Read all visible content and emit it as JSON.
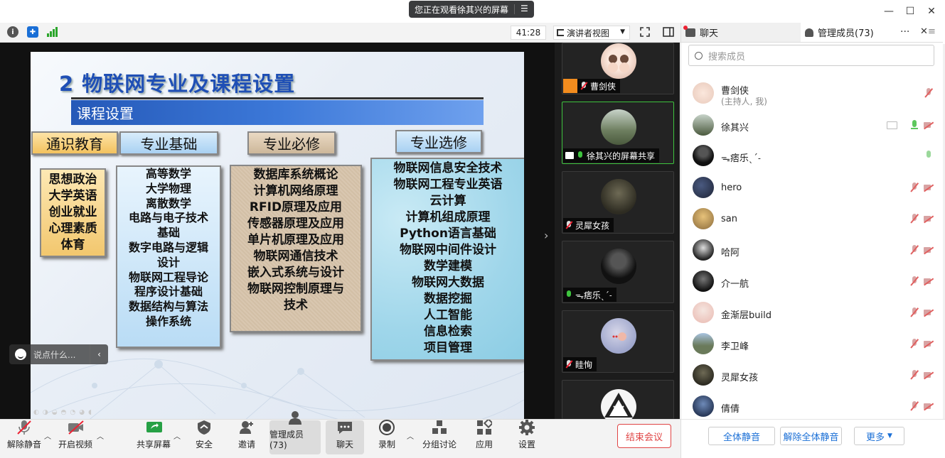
{
  "window": {
    "sharing_banner": "您正在观看徐其兴的屏幕"
  },
  "toolbar_top": {
    "timer": "41:28",
    "view_label": "演讲者视图"
  },
  "slide": {
    "title": "2 物联网专业及课程设置",
    "ribbon": "课程设置",
    "categories": [
      {
        "header": "通识教育",
        "items": [
          "思想政治",
          "大学英语",
          "创业就业",
          "心理素质",
          "体育"
        ]
      },
      {
        "header": "专业基础",
        "items": [
          "高等数学",
          "大学物理",
          "离散数学",
          "电路与电子技术",
          "基础",
          "数字电路与逻辑",
          "设计",
          "物联网工程导论",
          "程序设计基础",
          "数据结构与算法",
          "操作系统"
        ]
      },
      {
        "header": "专业必修",
        "items": [
          "数据库系统概论",
          "计算机网络原理",
          "RFID原理及应用",
          "传感器原理及应用",
          "单片机原理及应用",
          "物联网通信技术",
          "嵌入式系统与设计",
          "物联网控制原理与",
          "技术"
        ]
      },
      {
        "header": "专业选修",
        "items": [
          "物联网信息安全技术",
          "物联网工程专业英语",
          "云计算",
          "计算机组成原理",
          "Python语言基础",
          "物联网中间件设计",
          "数学建模",
          "物联网大数据",
          "数据挖掘",
          "人工智能",
          "信息检索",
          "项目管理"
        ]
      }
    ]
  },
  "chat_input": {
    "placeholder": "说点什么..."
  },
  "thumbnails": [
    {
      "name": "曹剑侠",
      "mic": "muted"
    },
    {
      "name": "徐其兴的屏幕共享",
      "mic": "on"
    },
    {
      "name": "灵犀女孩",
      "mic": "muted"
    },
    {
      "name": "ᯓ痞乐ˎˊ˗",
      "mic": "on"
    },
    {
      "name": "眭恂",
      "mic": "muted"
    }
  ],
  "bottom_toolbar": {
    "unmute": "解除静音",
    "video": "开启视频",
    "share": "共享屏幕",
    "security": "安全",
    "invite": "邀请",
    "members": "管理成员(73)",
    "chat": "聊天",
    "record": "录制",
    "breakout": "分组讨论",
    "apps": "应用",
    "settings": "设置",
    "end_meeting": "结束会议"
  },
  "right_panel": {
    "tab_chat": "聊天",
    "tab_members": "管理成员(73)",
    "search_placeholder": "搜索成员",
    "host_name": "曹剑侠",
    "host_note": "(主持人, 我)",
    "members": [
      {
        "name": "徐其兴",
        "status": "sharing"
      },
      {
        "name": "ᯓ痞乐ˎˊ˗",
        "status": "mic-on"
      },
      {
        "name": "hero",
        "status": "muted"
      },
      {
        "name": "san",
        "status": "muted"
      },
      {
        "name": "哈阿",
        "status": "muted"
      },
      {
        "name": "介一航",
        "status": "muted"
      },
      {
        "name": "金渐层build",
        "status": "muted"
      },
      {
        "name": "李卫峰",
        "status": "muted"
      },
      {
        "name": "灵犀女孩",
        "status": "muted"
      },
      {
        "name": "倩倩",
        "status": "muted"
      }
    ],
    "btn_mute_all": "全体静音",
    "btn_unmute_all": "解除全体静音",
    "btn_more": "更多"
  },
  "colors": {
    "accent": "#1a6fd6",
    "danger": "#e04444",
    "slide_title": "#1f4fb5"
  }
}
